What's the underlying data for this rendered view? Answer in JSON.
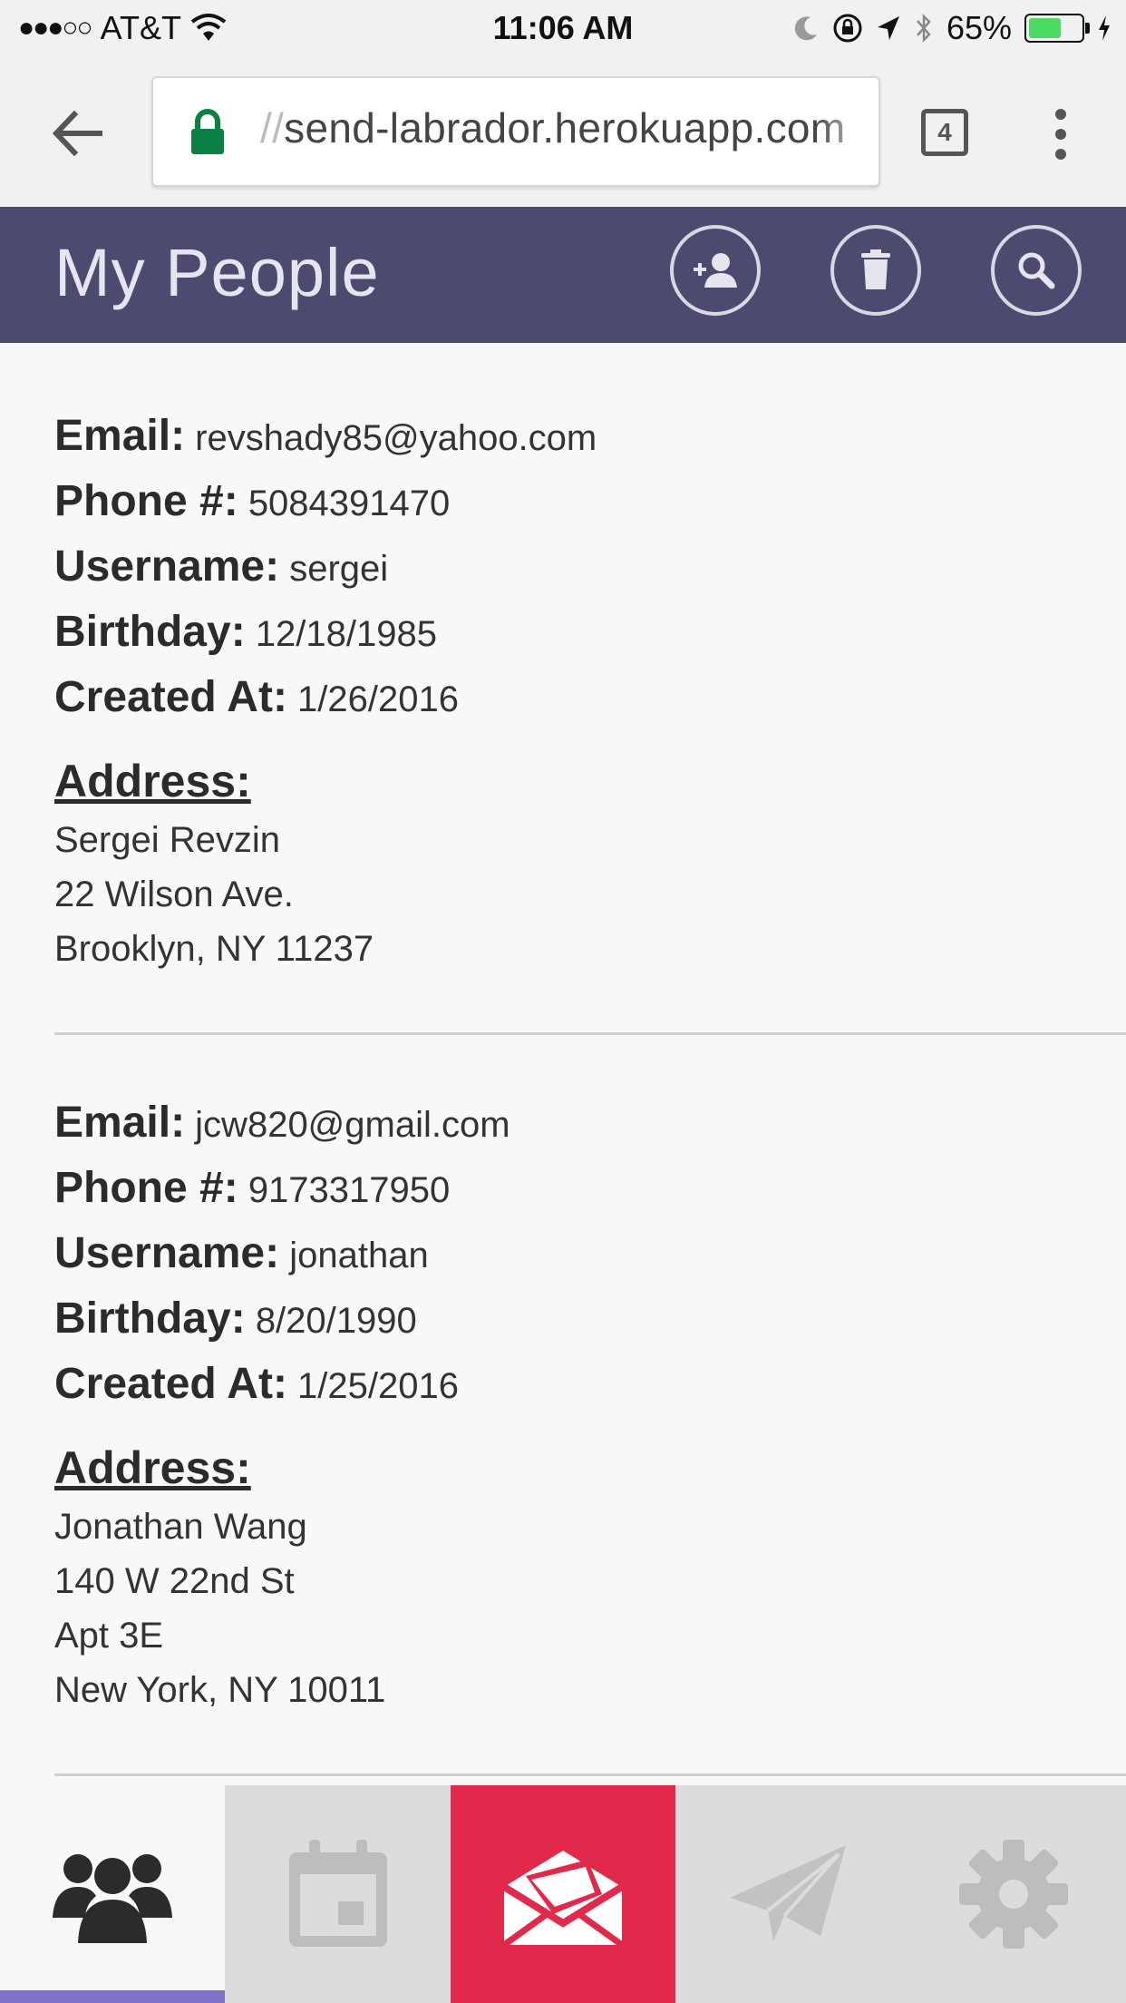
{
  "status_bar": {
    "carrier": "AT&T",
    "time": "11:06 AM",
    "battery_pct_label": "65%",
    "battery_level": 0.65,
    "signal_dots": "●●●○○"
  },
  "browser": {
    "url_prefix": "//",
    "url_domain": "send-labrador.herokuapp.com",
    "tab_count": "4"
  },
  "app": {
    "title": "My People",
    "header_color": "#4c4a6e",
    "accent_color": "#e1294b"
  },
  "labels": {
    "email": "Email:",
    "phone": "Phone #:",
    "username": "Username:",
    "birthday": "Birthday:",
    "created": "Created At:",
    "address": "Address:"
  },
  "people": [
    {
      "email": "revshady85@yahoo.com",
      "phone": "5084391470",
      "username": "sergei",
      "birthday": "12/18/1985",
      "created": "1/26/2016",
      "address": [
        "Sergei Revzin",
        "22 Wilson Ave.",
        "Brooklyn, NY 11237"
      ]
    },
    {
      "email": "jcw820@gmail.com",
      "phone": "9173317950",
      "username": "jonathan",
      "birthday": "8/20/1990",
      "created": "1/25/2016",
      "address": [
        "Jonathan Wang",
        "140 W 22nd St",
        "Apt 3E",
        "New York, NY 10011"
      ]
    }
  ],
  "nav": [
    {
      "icon": "people-icon",
      "active": true
    },
    {
      "icon": "calendar-icon",
      "active": false
    },
    {
      "icon": "envelope-icon",
      "active": false
    },
    {
      "icon": "paper-plane-icon",
      "active": false
    },
    {
      "icon": "gear-icon",
      "active": false
    }
  ]
}
